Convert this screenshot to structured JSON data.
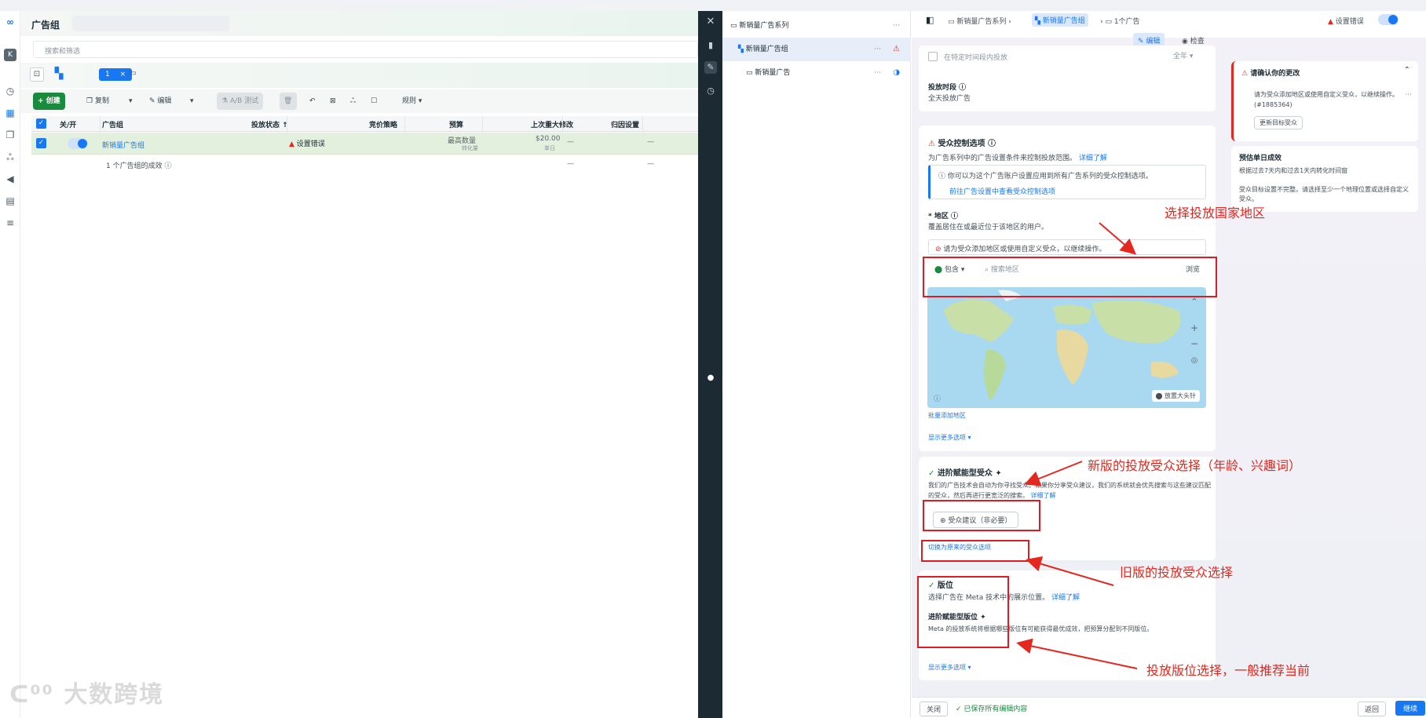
{
  "left": {
    "header_title": "广告组",
    "search_placeholder": "搜索和筛选",
    "tab_count": "1",
    "tab_close": "×",
    "toolbar": {
      "create": "+ 创建",
      "copy": "复制",
      "edit": "编辑",
      "ab_test": "A/B 测试",
      "rules": "规则"
    },
    "columns": [
      "关/开",
      "广告组",
      "投放状态 ↑",
      "竞价策略",
      "预算",
      "上次重大修改",
      "归因设置"
    ],
    "row": {
      "name": "新销量广告组",
      "status": "设置错误",
      "bid": "最高数量",
      "bid_sub": "转化量",
      "budget": "$20.00",
      "budget_sub": "单日",
      "last_edit": "—",
      "attribution": "—"
    },
    "summary": {
      "text": "1 个广告组的成效",
      "last_edit": "—",
      "attribution": "—"
    },
    "watermark": "大数跨境"
  },
  "tree": {
    "campaign": "新销量广告系列",
    "adset": "新销量广告组",
    "ad": "新销量广告",
    "dots": "···"
  },
  "right": {
    "breadcrumb": {
      "campaign": "新销量广告系列",
      "adset": "新销量广告组",
      "ad": "1个广告",
      "error": "设置错误"
    },
    "mode": {
      "edit": "编辑",
      "review": "检查"
    },
    "schedule_partial": "在特定时间段内投放",
    "schedule_select": "全年",
    "schedule_title": "投放时段",
    "schedule_value": "全天投放广告",
    "audience_controls": {
      "title": "受众控制选项",
      "desc": "为广告系列中的广告设置条件来控制投放范围。",
      "desc_link": "详细了解",
      "info": "你可以为这个广告账户设置应用到所有广告系列的受众控制选项。",
      "info_link": "前往广告设置中查看受众控制选项"
    },
    "location": {
      "label": "* 地区",
      "desc": "覆盖居住在或最近位于该地区的用户。",
      "error": "请为受众添加地区或使用自定义受众，以继续操作。",
      "include": "包含",
      "search_placeholder": "搜索地区",
      "browse": "浏览",
      "pin": "放置大头针",
      "bulk": "批量添加地区",
      "more": "显示更多选项 ▾"
    },
    "advantage_audience": {
      "title": "进阶赋能型受众",
      "desc": "我们的广告技术会自动为你寻找受众。如果你分享受众建议，我们的系统就会优先搜索与这些建议匹配的受众，然后再进行更宽泛的搜索。",
      "desc_link": "详细了解",
      "suggest": "受众建议（非必要）",
      "switch": "切换为原来的受众选项"
    },
    "placements": {
      "title": "版位",
      "desc": "选择广告在 Meta 技术中的展示位置。",
      "desc_link": "详细了解",
      "sub_title": "进阶赋能型版位",
      "sub_desc": "Meta 的投放系统将根据哪些版位有可能获得最优成效，把预算分配到不同版位。",
      "more": "显示更多选项 ▾"
    },
    "review_card": {
      "title": "请确认你的更改",
      "desc": "请为受众添加地区或使用自定义受众，以继续操作。(#1885364)",
      "button": "更新目标受众"
    },
    "estimate_card": {
      "title": "预估单日成效",
      "desc": "根据过去7天内和过去1天内转化时间窗",
      "desc2": "受众目标设置不完整。请选择至少一个地理位置或选择自定义受众。"
    },
    "footer": {
      "close": "关闭",
      "saved": "✓ 已保存所有编辑内容",
      "back": "返回",
      "next": "继续"
    }
  },
  "annotations": {
    "a1": "选择投放国家地区",
    "a2": "新版的投放受众选择（年龄、兴趣词）",
    "a3": "旧版的投放受众选择",
    "a4": "投放版位选择，一般推荐当前"
  },
  "colors": {
    "accent": "#1877f2",
    "create_green": "#1a8a3f",
    "annotation_red": "#e5281f",
    "dark_sidebar": "#1c2b33"
  }
}
